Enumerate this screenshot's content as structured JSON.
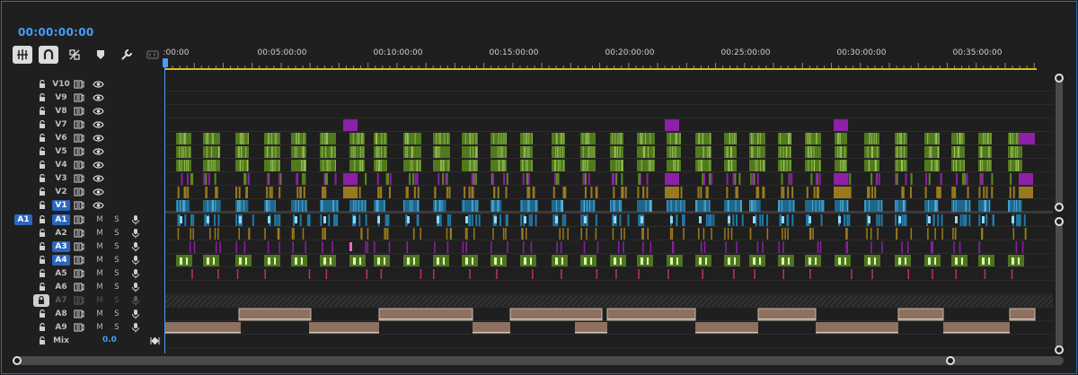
{
  "timecode": "00:00:00:00",
  "toolbar": {
    "tools": [
      "insert-sequence-icon",
      "snap-magnet-icon",
      "linked-selection-icon",
      "add-marker-icon",
      "settings-wrench-icon",
      "captions-icon"
    ]
  },
  "ruler": {
    "labels": [
      ":00:00",
      "00:05:00:00",
      "00:10:00:00",
      "00:15:00:00",
      "00:20:00:00",
      "00:25:00:00",
      "00:30:00:00",
      "00:35:00:00"
    ]
  },
  "video_tracks": [
    {
      "name": "V10"
    },
    {
      "name": "V9"
    },
    {
      "name": "V8"
    },
    {
      "name": "V7"
    },
    {
      "name": "V6"
    },
    {
      "name": "V5"
    },
    {
      "name": "V4"
    },
    {
      "name": "V3"
    },
    {
      "name": "V2"
    },
    {
      "name": "V1",
      "targeted": true
    }
  ],
  "audio_tracks": [
    {
      "name": "A1",
      "targeted": true,
      "source": "A1"
    },
    {
      "name": "A2"
    },
    {
      "name": "A3",
      "targeted": true
    },
    {
      "name": "A4",
      "targeted": true
    },
    {
      "name": "A5"
    },
    {
      "name": "A6"
    },
    {
      "name": "A7",
      "disabled": true
    },
    {
      "name": "A8"
    },
    {
      "name": "A9"
    }
  ],
  "audio_buttons": {
    "mute": "M",
    "solo": "S"
  },
  "mix": {
    "label": "Mix",
    "value": "0.0"
  },
  "colors": {
    "accent": "#4a9df8",
    "green_clip": "#5a8a1e",
    "purple_clip": "#8e1fa8",
    "gold_clip": "#9a7a1e",
    "blue_clip": "#1e7aa8",
    "tan_clip": "#8e7060",
    "pink_clip": "#c0306a"
  }
}
